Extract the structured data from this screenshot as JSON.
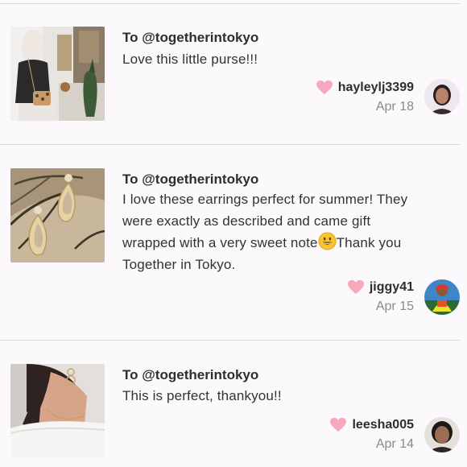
{
  "reviews": [
    {
      "to": "To @togetherintokyo",
      "comment": "Love this little purse!!!",
      "username": "hayleylj3399",
      "date": "Apr 18",
      "thumb_icon": "purse-photo",
      "avatar_icon": "user-avatar"
    },
    {
      "to": "To @togetherintokyo",
      "comment_line1": "I love these earrings perfect for summer! They",
      "comment_line2": "were exactly as described and came gift",
      "comment_line3a": "wrapped with a very sweet note",
      "comment_line3b": "Thank you",
      "comment_line4": "Together in Tokyo.",
      "emoji": "grinning-face",
      "username": "jiggy41",
      "date": "Apr 15",
      "thumb_icon": "earrings-photo",
      "avatar_icon": "user-avatar"
    },
    {
      "to": "To @togetherintokyo",
      "comment": "This is perfect, thankyou!!",
      "username": "leesha005",
      "date": "Apr 14",
      "thumb_icon": "model-photo",
      "avatar_icon": "user-avatar"
    }
  ],
  "colors": {
    "background": "#fbf9fb",
    "heart": "#f7a8bd",
    "divider": "#dcdadc",
    "date": "#8a8a8a"
  }
}
